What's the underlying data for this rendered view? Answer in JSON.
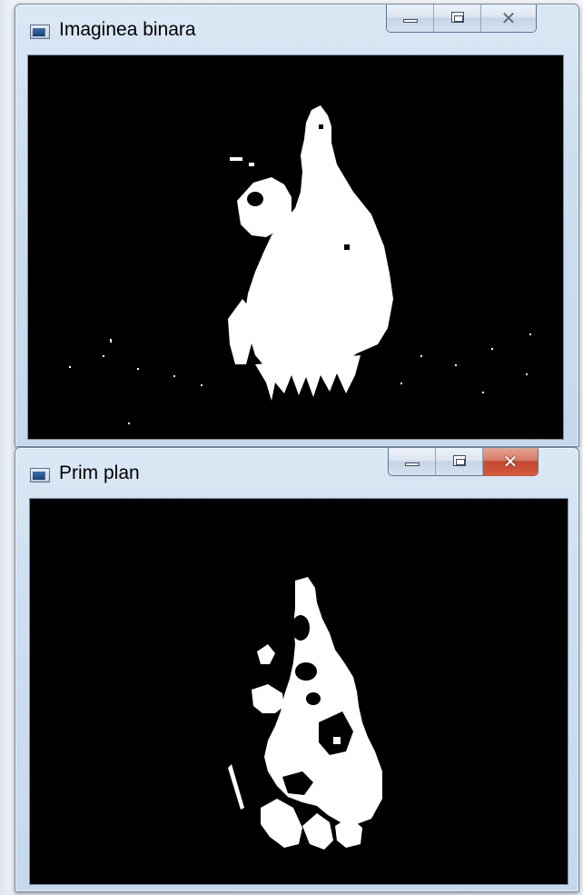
{
  "windows": [
    {
      "title": "Imaginea binara",
      "icon": "app-window-icon",
      "close_active": false
    },
    {
      "title": "Prim plan",
      "icon": "app-window-icon",
      "close_active": true
    }
  ],
  "colors": {
    "foreground": "#ffffff",
    "background": "#000000",
    "close_active": "#c3482d"
  }
}
